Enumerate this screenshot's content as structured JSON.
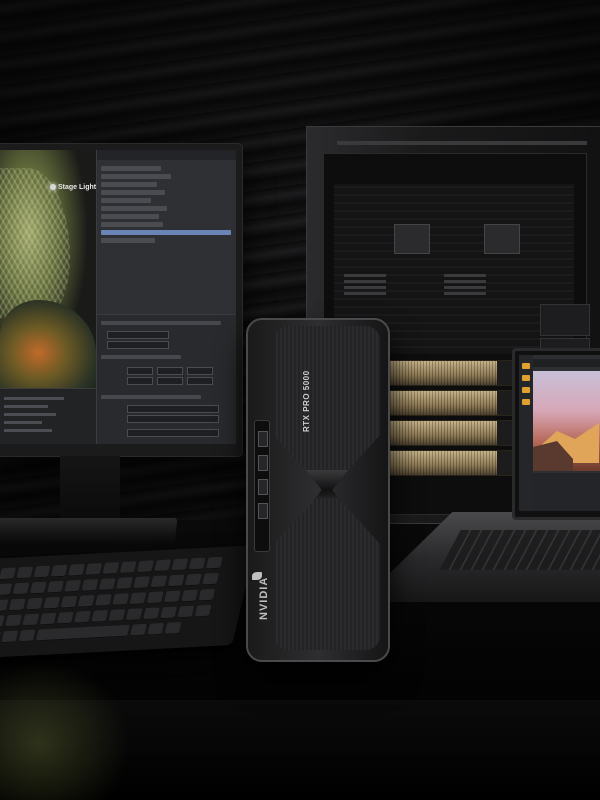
{
  "monitor": {
    "viewport_label": "Stage Lights"
  },
  "gpu": {
    "model_text": "RTX PRO 5000",
    "brand_text": "NVIDIA"
  },
  "colors": {
    "background": "#050505",
    "monitor_ui": "#2f3033",
    "selection": "#6a84b8",
    "gpu_heatsink_gold": "#c9b58a",
    "laptop_accent": "#e0a030"
  },
  "icons": {
    "viewport_light": "light-bulb-icon",
    "nvidia_logo": "nvidia-eye-logo"
  }
}
